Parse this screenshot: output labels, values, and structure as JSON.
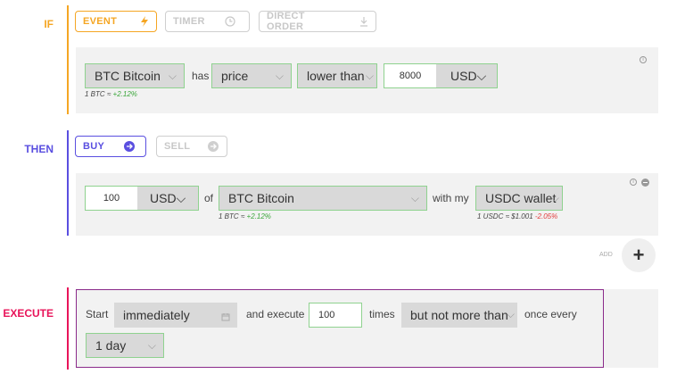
{
  "if_section": {
    "label": "IF",
    "tabs": [
      {
        "label": "EVENT",
        "icon": "lightning-icon"
      },
      {
        "label": "TIMER",
        "icon": "clock-icon"
      },
      {
        "label": "DIRECT ORDER",
        "icon": "download-icon"
      }
    ],
    "asset": "BTC Bitcoin",
    "has_text": "has",
    "property": "price",
    "comparison": "lower than",
    "value": "8000",
    "currency": "USD",
    "rate_note_prefix": "1 BTC ≈",
    "rate_note_change": "+2.12%"
  },
  "then_section": {
    "label": "THEN",
    "tabs": [
      {
        "label": "BUY",
        "icon": "arrow-right-icon"
      },
      {
        "label": "SELL",
        "icon": "arrow-right-icon"
      }
    ],
    "amount": "100",
    "currency": "USD",
    "of_text": "of",
    "asset": "BTC Bitcoin",
    "asset_note_prefix": "1 BTC ≈",
    "asset_note_change": "+2.12%",
    "with_my_text": "with my",
    "wallet": "USDC wallet",
    "wallet_note_prefix": "1 USDC ≈ $1.001",
    "wallet_note_change": "-2.05%",
    "add_label": "ADD"
  },
  "execute_section": {
    "label": "EXECUTE",
    "start_text": "Start",
    "start_value": "immediately",
    "and_execute_text": "and execute",
    "times_value": "100",
    "times_text": "times",
    "limit_value": "but not more than",
    "once_every_text": "once every",
    "interval_value": "1 day"
  },
  "colors": {
    "if_accent": "#f5a623",
    "then_accent": "#5a4fe0",
    "execute_accent": "#e8145a",
    "execute_border": "#8a2a8a",
    "valid_border": "#8fd28f"
  }
}
